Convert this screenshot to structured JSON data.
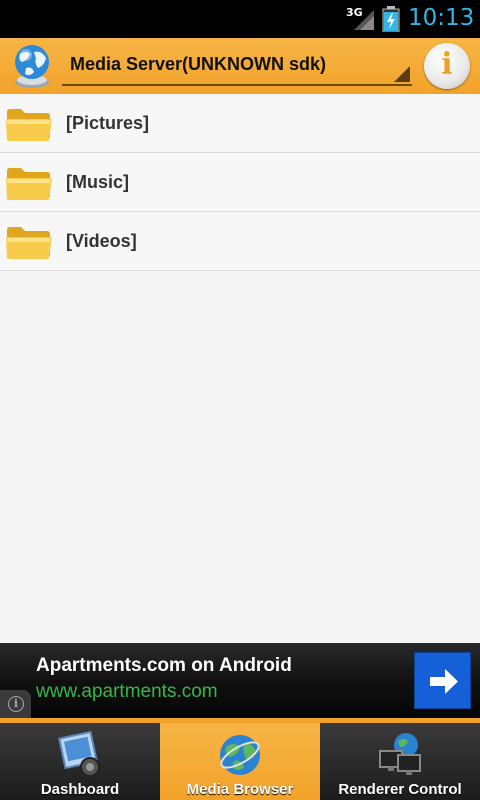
{
  "status_bar": {
    "network": "3G",
    "time": "10:13",
    "time_color": "#33b5e5"
  },
  "action_bar": {
    "server_name": "Media Server(UNKNOWN sdk)",
    "app_icon": "globe-icon",
    "info_icon": "info-icon",
    "accent": "#f2a22a"
  },
  "folders": [
    {
      "label": "[Pictures]",
      "icon": "folder-icon"
    },
    {
      "label": "[Music]",
      "icon": "folder-icon"
    },
    {
      "label": "[Videos]",
      "icon": "folder-icon"
    }
  ],
  "ad": {
    "title": "Apartments.com on Android",
    "url": "www.apartments.com",
    "url_color": "#39b54a",
    "button_icon": "arrow-right-icon",
    "button_color": "#1560d8"
  },
  "tabs": [
    {
      "label": "Dashboard",
      "icon": "dashboard-icon",
      "active": false
    },
    {
      "label": "Media Browser",
      "icon": "globe-icon",
      "active": true
    },
    {
      "label": "Renderer Control",
      "icon": "monitors-icon",
      "active": false
    }
  ]
}
